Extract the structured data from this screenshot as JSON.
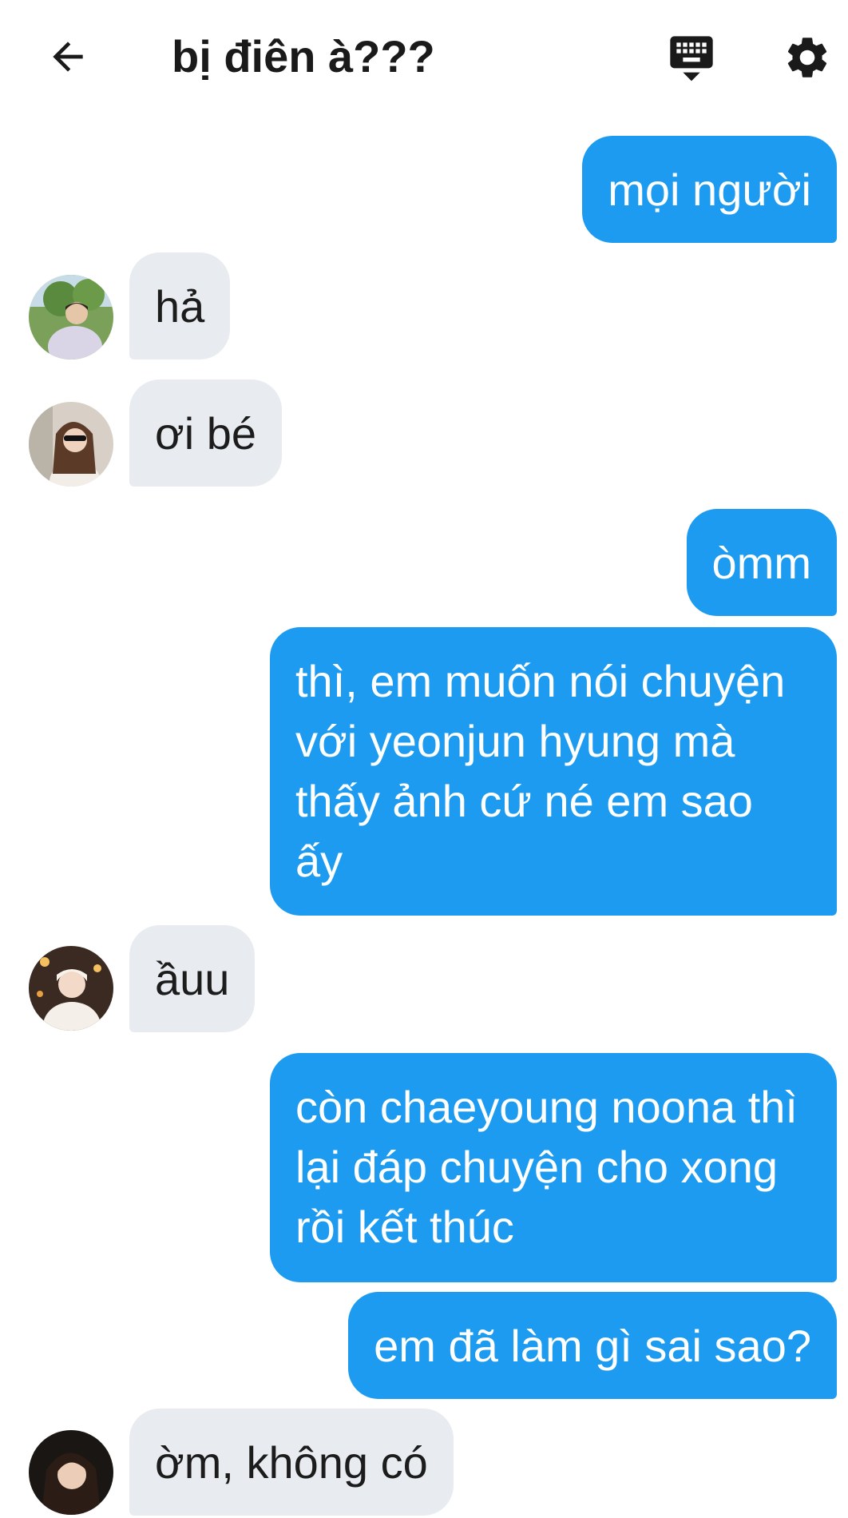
{
  "header": {
    "title": "bị điên à???",
    "back_icon": "arrow-left-icon",
    "keyboard_icon": "keyboard-icon",
    "settings_icon": "gear-icon"
  },
  "colors": {
    "outgoing_bubble": "#1d9bf0",
    "incoming_bubble": "#e8ebf0"
  },
  "messages": [
    {
      "direction": "out",
      "text": "mọi người"
    },
    {
      "direction": "in",
      "avatar": "avatar-1",
      "text": "hả"
    },
    {
      "direction": "in",
      "avatar": "avatar-2",
      "text": "ơi bé"
    },
    {
      "direction": "out",
      "text": "òmm"
    },
    {
      "direction": "out",
      "text": "thì, em muốn nói chuyện với yeonjun hyung mà thấy ảnh cứ né em sao ấy"
    },
    {
      "direction": "in",
      "avatar": "avatar-3",
      "text": "ầuu"
    },
    {
      "direction": "out",
      "text": "còn chaeyoung noona thì lại đáp chuyện cho xong rồi kết thúc"
    },
    {
      "direction": "out",
      "text": "em đã làm gì sai sao?"
    },
    {
      "direction": "in",
      "avatar": "avatar-4",
      "text": "ờm, không có"
    }
  ]
}
